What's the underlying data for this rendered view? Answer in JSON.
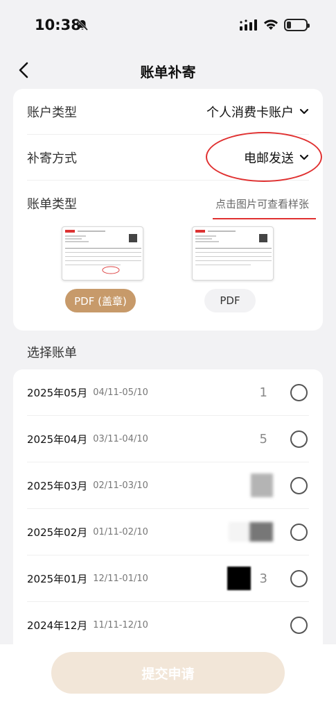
{
  "status_bar": {
    "time": "10:38"
  },
  "nav": {
    "title": "账单补寄"
  },
  "account_type": {
    "label": "账户类型",
    "value": "个人消费卡账户"
  },
  "mail_method": {
    "label": "补寄方式",
    "value": "电邮发送"
  },
  "bill_type": {
    "label": "账单类型",
    "hint": "点击图片可查看样张",
    "options": [
      {
        "label": "PDF (盖章)",
        "selected": true
      },
      {
        "label": "PDF",
        "selected": false
      }
    ]
  },
  "select_bill": {
    "title": "选择账单",
    "rows": [
      {
        "month": "2025年05月",
        "range": "04/11-05/10",
        "amount_partial": "1"
      },
      {
        "month": "2025年04月",
        "range": "03/11-04/10",
        "amount_partial": "5"
      },
      {
        "month": "2025年03月",
        "range": "02/11-03/10",
        "amount_partial": ""
      },
      {
        "month": "2025年02月",
        "range": "01/11-02/10",
        "amount_partial": ""
      },
      {
        "month": "2025年01月",
        "range": "12/11-01/10",
        "amount_partial": "3"
      },
      {
        "month": "2024年12月",
        "range": "11/11-12/10",
        "amount_partial": ""
      }
    ]
  },
  "submit": {
    "label": "提交申请"
  },
  "colors": {
    "accent": "#c79a6a",
    "annotation": "#e03030",
    "submit_disabled": "#f2e6d8"
  }
}
